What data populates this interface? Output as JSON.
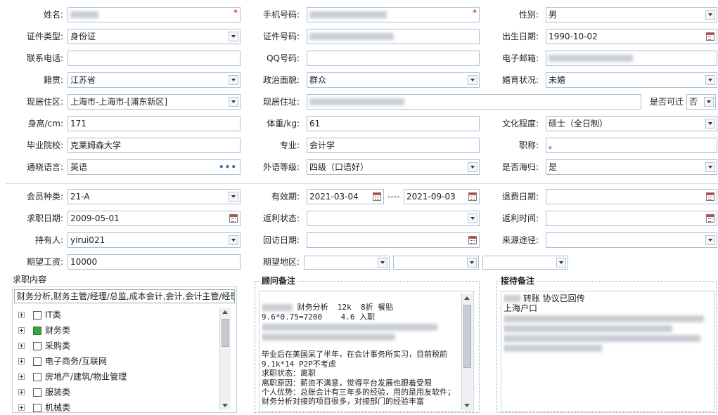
{
  "form": {
    "name": {
      "label": "姓名:",
      "required_mark": "*"
    },
    "mobile": {
      "label": "手机号码:",
      "required_mark": "*"
    },
    "gender": {
      "label": "性别:",
      "value": "男"
    },
    "id_type": {
      "label": "证件类型:",
      "value": "身份证"
    },
    "id_number": {
      "label": "证件号码:"
    },
    "birth_date": {
      "label": "出生日期:",
      "value": "1990-10-02"
    },
    "phone": {
      "label": "联系电话:",
      "value": ""
    },
    "qq": {
      "label": "QQ号码:",
      "value": ""
    },
    "email": {
      "label": "电子邮箱:"
    },
    "native_place": {
      "label": "籍贯:",
      "value": "江苏省"
    },
    "political_status": {
      "label": "政治面貌:",
      "value": "群众"
    },
    "marital_status": {
      "label": "婚育状况:",
      "value": "未婚"
    },
    "current_residence": {
      "label": "现居住区:",
      "value": "上海市-上海市-[浦东新区]"
    },
    "current_address": {
      "label": "现居住址:"
    },
    "relocatable": {
      "label": "是否可迁",
      "value": "否"
    },
    "height": {
      "label": "身高/cm:",
      "value": "171"
    },
    "weight": {
      "label": "体重/kg:",
      "value": "61"
    },
    "education": {
      "label": "文化程度:",
      "value": "硕士（全日制）"
    },
    "school": {
      "label": "毕业院校:",
      "value": "克莱姆森大学"
    },
    "major": {
      "label": "专业:",
      "value": "会计学"
    },
    "title": {
      "label": "职称:",
      "value": "。"
    },
    "language": {
      "label": "通晓语言:",
      "value": "英语",
      "more": "•••"
    },
    "foreign_level": {
      "label": "外语等级:",
      "value": "四级（口语好）"
    },
    "overseas": {
      "label": "是否海归:",
      "value": "是"
    }
  },
  "membership": {
    "member_type": {
      "label": "会员种类:",
      "value": "21-A"
    },
    "validity": {
      "label": "有效期:",
      "start": "2021-03-04",
      "separator": "----",
      "end": "2021-09-03"
    },
    "refund_date": {
      "label": "退费日期:",
      "value": ""
    },
    "job_seek_date": {
      "label": "求职日期:",
      "value": "2009-05-01"
    },
    "rebate_status": {
      "label": "返利状态:",
      "value": ""
    },
    "rebate_time": {
      "label": "返利时间:",
      "value": ""
    },
    "holder": {
      "label": "持有人:",
      "value": "yirui021"
    },
    "revisit_date": {
      "label": "回访日期:",
      "value": ""
    },
    "source": {
      "label": "来源途径:",
      "value": ""
    },
    "expected_salary": {
      "label": "期望工资:",
      "value": "10000"
    },
    "expected_region": {
      "label": "期望地区:"
    }
  },
  "job_content": {
    "title": "求职内容",
    "summary": "财务分析,财务主管/经理/总监,成本会计,会计,会计主管/经理",
    "categories": [
      {
        "label": "IT类",
        "checked": false
      },
      {
        "label": "财务类",
        "checked": true
      },
      {
        "label": "采购类",
        "checked": false
      },
      {
        "label": "电子商务/互联网",
        "checked": false
      },
      {
        "label": "房地产/建筑/物业管理",
        "checked": false
      },
      {
        "label": "服装类",
        "checked": false
      },
      {
        "label": "机械类",
        "checked": false
      }
    ]
  },
  "consultant_notes": {
    "title": "顾问备注",
    "line1": "财务分析  12k  8折 餐贴",
    "line2": "9.6*0.75=7200    4.6 入职",
    "body": "毕业后在美国呆了半年，在会计事务所实习，目前税前9.1k*14 P2P不考虑\n求职状态：离职\n离职原因：薪资不满意，觉得平台发展也跟着受限\n个人优势：总账会计有三年多的经验，用的是用友软件；财务分析对接的项目很多，对接部门的经验丰富"
  },
  "reception_notes": {
    "title": "接待备注",
    "line1": "转账 协议已回传",
    "line2": "上海户口"
  }
}
